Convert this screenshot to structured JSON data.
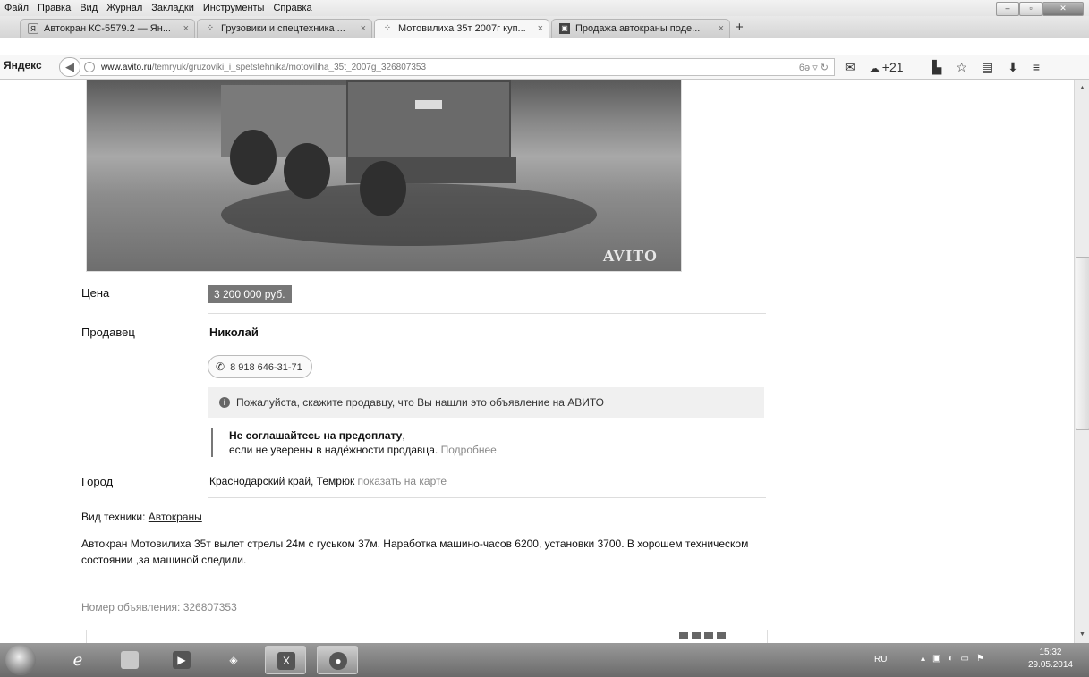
{
  "menu": [
    "Файл",
    "Правка",
    "Вид",
    "Журнал",
    "Закладки",
    "Инструменты",
    "Справка"
  ],
  "tabs": [
    {
      "label": "Автокран КС-5579.2 — Ян...",
      "icon": "yandex-icon"
    },
    {
      "label": "Грузовики и спецтехника ...",
      "icon": "avito-icon"
    },
    {
      "label": "Мотовилиха 35т 2007г куп...",
      "icon": "avito-icon",
      "active": true
    },
    {
      "label": "Продажа автокраны поде...",
      "icon": "page-icon"
    }
  ],
  "nav": {
    "brand": "Яндекс",
    "url_host": "www.avito.ru",
    "url_path": "/temryuk/gruzoviki_i_spetstehnika/motoviliha_35t_2007g_326807353",
    "weather": "+21"
  },
  "photo": {
    "watermark": "AVITO"
  },
  "listing": {
    "price_label": "Цена",
    "price": "3 200 000 руб.",
    "seller_label": "Продавец",
    "seller_name": "Николай",
    "phone": "8 918 646-31-71",
    "notice": "Пожалуйста, скажите продавцу, что Вы нашли это объявление на АВИТО",
    "warning_title": "Не соглашайтесь на предоплату",
    "warning_text": "если не уверены в надёжности продавца.",
    "warning_link": "Подробнее",
    "city_label": "Город",
    "city": "Краснодарский край, Темрюк",
    "map_link": "показать на карте",
    "type_label": "Вид техники:",
    "type_value": "Автокраны",
    "description": "Автокран Мотовилиха 35т вылет стрелы 24м с гуськом 37м. Наработка машино-часов 6200, установки 3700. В хорошем техническом состоянии ,за машиной следили.",
    "ad_number_label": "Номер объявления:",
    "ad_number": "326807353"
  },
  "taskbar": {
    "lang": "RU",
    "time": "15:32",
    "date": "29.05.2014"
  }
}
